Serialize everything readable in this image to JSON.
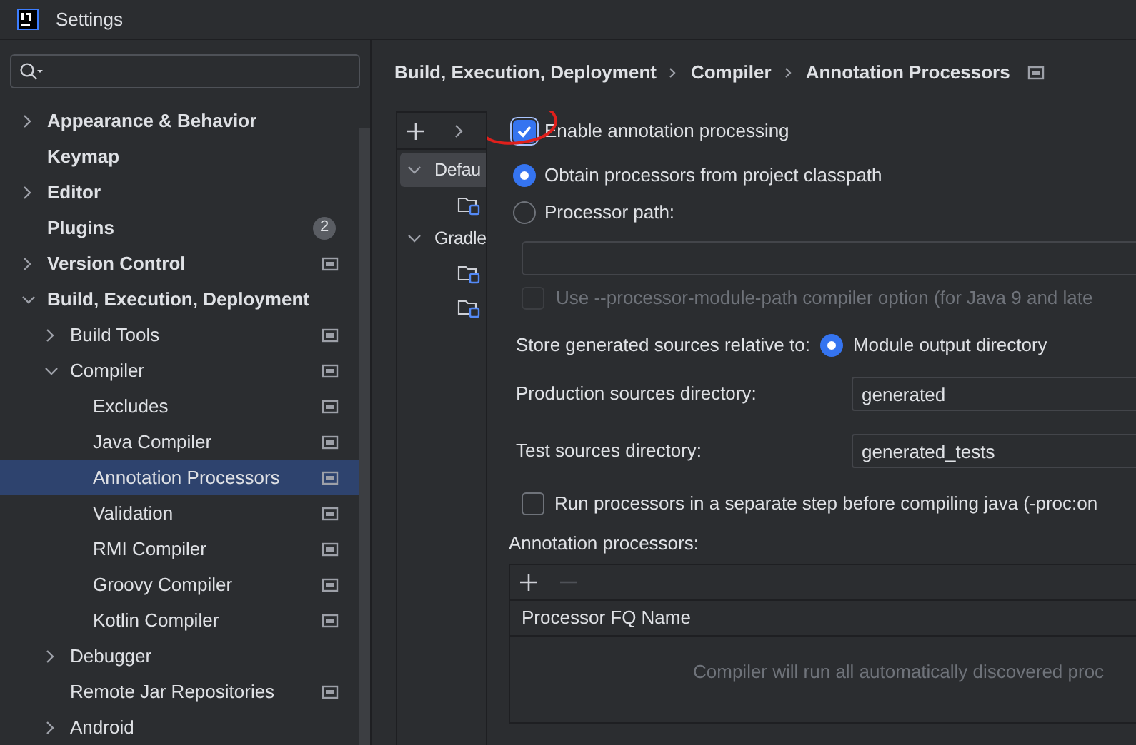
{
  "window": {
    "title": "Settings"
  },
  "sidebar": {
    "items": [
      {
        "label": "Appearance & Behavior",
        "expanded": false,
        "has_children": true,
        "selected": false,
        "project_level": false
      },
      {
        "label": "Keymap",
        "has_children": false,
        "selected": false,
        "project_level": false
      },
      {
        "label": "Editor",
        "expanded": false,
        "has_children": true,
        "selected": false,
        "project_level": false
      },
      {
        "label": "Plugins",
        "has_children": false,
        "selected": false,
        "project_level": false,
        "badge": "2"
      },
      {
        "label": "Version Control",
        "expanded": false,
        "has_children": true,
        "selected": false,
        "project_level": true
      },
      {
        "label": "Build, Execution, Deployment",
        "expanded": true,
        "has_children": true,
        "selected": false,
        "project_level": false,
        "children": [
          {
            "label": "Build Tools",
            "expanded": false,
            "has_children": true,
            "selected": false,
            "project_level": true
          },
          {
            "label": "Compiler",
            "expanded": true,
            "has_children": true,
            "selected": false,
            "project_level": true,
            "children": [
              {
                "label": "Excludes",
                "has_children": false,
                "selected": false,
                "project_level": true
              },
              {
                "label": "Java Compiler",
                "has_children": false,
                "selected": false,
                "project_level": true
              },
              {
                "label": "Annotation Processors",
                "has_children": false,
                "selected": true,
                "project_level": true
              },
              {
                "label": "Validation",
                "has_children": false,
                "selected": false,
                "project_level": true
              },
              {
                "label": "RMI Compiler",
                "has_children": false,
                "selected": false,
                "project_level": true
              },
              {
                "label": "Groovy Compiler",
                "has_children": false,
                "selected": false,
                "project_level": true
              },
              {
                "label": "Kotlin Compiler",
                "has_children": false,
                "selected": false,
                "project_level": true
              }
            ]
          },
          {
            "label": "Debugger",
            "expanded": false,
            "has_children": true,
            "selected": false,
            "project_level": false
          },
          {
            "label": "Remote Jar Repositories",
            "has_children": false,
            "selected": false,
            "project_level": true
          },
          {
            "label": "Android",
            "expanded": false,
            "has_children": true,
            "selected": false,
            "project_level": false
          }
        ]
      }
    ]
  },
  "breadcrumb": {
    "parts": [
      "Build, Execution, Deployment",
      "Compiler",
      "Annotation Processors"
    ],
    "project_level": true
  },
  "profiles": {
    "items": [
      {
        "label": "Defau",
        "selected": true,
        "expanded": true,
        "children": [
          {
            "selected": false
          }
        ]
      },
      {
        "label": "Gradle",
        "selected": false,
        "expanded": true,
        "children": [
          {
            "selected": false
          },
          {
            "selected": false
          }
        ]
      }
    ]
  },
  "form": {
    "enable_processing": {
      "label": "Enable annotation processing",
      "checked": true,
      "annotated": true
    },
    "source_options": [
      {
        "label": "Obtain processors from project classpath",
        "selected": true
      },
      {
        "label": "Processor path:",
        "selected": false
      }
    ],
    "module_path_option": {
      "label": "Use --processor-module-path compiler option (for Java 9 and late",
      "checked": false,
      "disabled": true
    },
    "store_relative": {
      "label": "Store generated sources relative to:",
      "options": [
        {
          "label": "Module output directory",
          "selected": true
        }
      ]
    },
    "fields": [
      {
        "label": "Production sources directory:",
        "value": "generated"
      },
      {
        "label": "Test sources directory:",
        "value": "generated_tests"
      }
    ],
    "separate_step": {
      "label": "Run processors in a separate step before compiling java (-proc:on",
      "checked": false,
      "disabled": false
    },
    "processors_table": {
      "title": "Annotation processors:",
      "remove_disabled": true,
      "columns": [
        "Processor FQ Name"
      ],
      "empty_text": "Compiler will run all automatically discovered proc"
    }
  }
}
